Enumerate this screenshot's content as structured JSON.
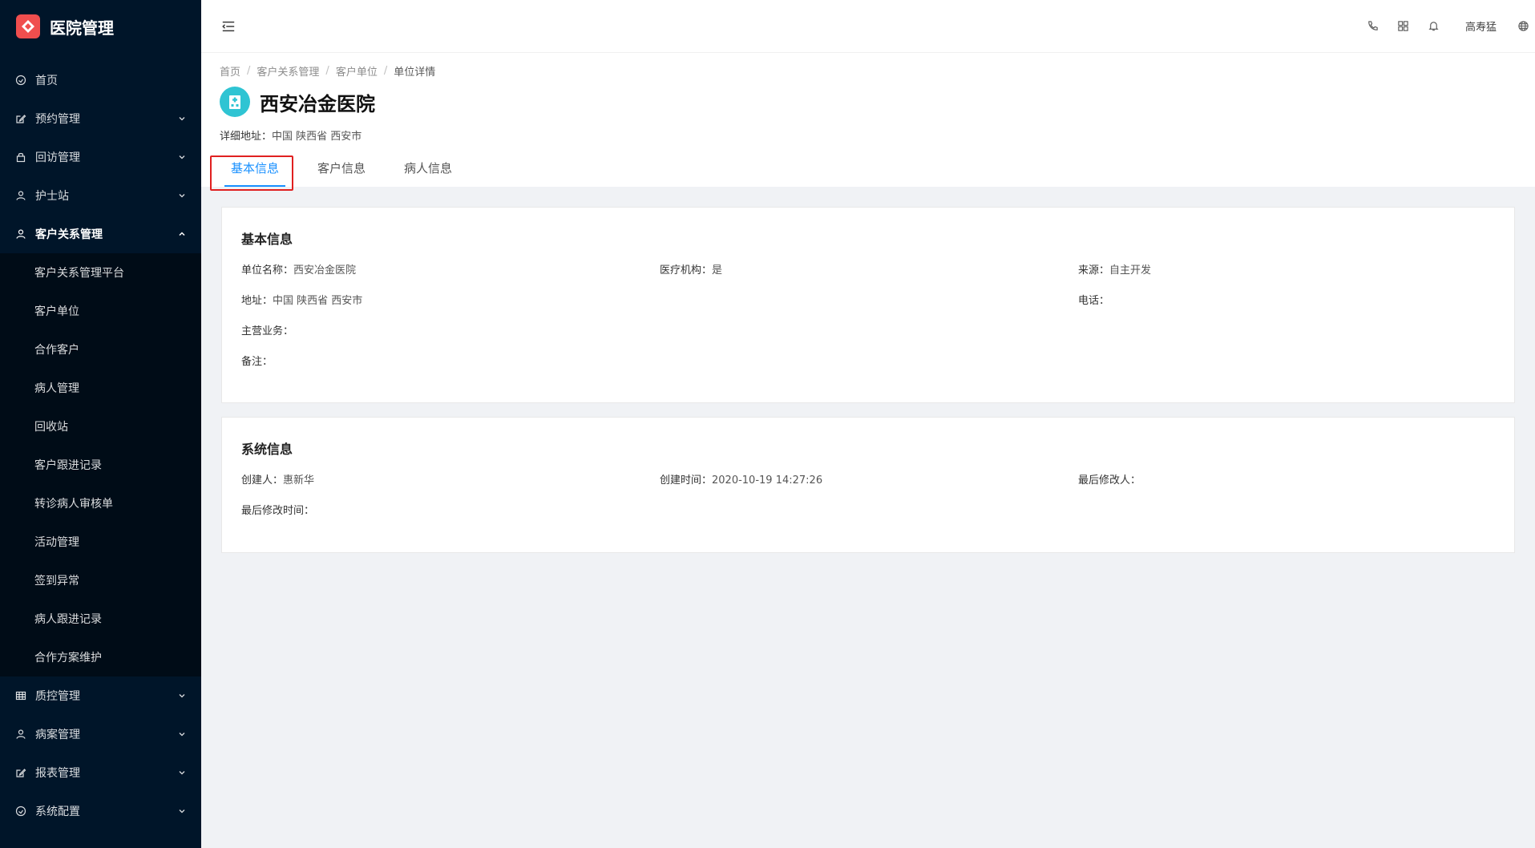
{
  "app": {
    "title": "医院管理"
  },
  "sidebar": {
    "items": [
      {
        "label": "首页",
        "icon": "dashboard-icon",
        "has_arrow": false
      },
      {
        "label": "预约管理",
        "icon": "edit-icon",
        "has_arrow": true
      },
      {
        "label": "回访管理",
        "icon": "lock-icon",
        "has_arrow": true
      },
      {
        "label": "护士站",
        "icon": "user-icon",
        "has_arrow": true
      },
      {
        "label": "客户关系管理",
        "icon": "user-icon",
        "has_arrow": true,
        "open": true
      },
      {
        "label": "质控管理",
        "icon": "table-icon",
        "has_arrow": true
      },
      {
        "label": "病案管理",
        "icon": "user-icon",
        "has_arrow": true
      },
      {
        "label": "报表管理",
        "icon": "edit-icon",
        "has_arrow": true
      },
      {
        "label": "系统配置",
        "icon": "dashboard-icon",
        "has_arrow": true
      }
    ],
    "submenu": [
      "客户关系管理平台",
      "客户单位",
      "合作客户",
      "病人管理",
      "回收站",
      "客户跟进记录",
      "转诊病人审核单",
      "活动管理",
      "签到异常",
      "病人跟进记录",
      "合作方案维护"
    ]
  },
  "header": {
    "user_name": "高寿猛",
    "icons": [
      "phone-icon",
      "apps-icon",
      "bell-icon",
      "globe-icon"
    ]
  },
  "breadcrumb": [
    "首页",
    "客户关系管理",
    "客户单位",
    "单位详情"
  ],
  "page": {
    "title": "西安冶金医院",
    "address_label": "详细地址：",
    "address_value": "中国 陕西省 西安市"
  },
  "tabs": [
    "基本信息",
    "客户信息",
    "病人信息"
  ],
  "basic_info": {
    "title": "基本信息",
    "fields": [
      {
        "label": "单位名称：",
        "value": "西安冶金医院"
      },
      {
        "label": "医疗机构：",
        "value": "是"
      },
      {
        "label": "来源：",
        "value": "自主开发"
      },
      {
        "label": "地址：",
        "value": "中国 陕西省 西安市"
      },
      {
        "label": "",
        "value": ""
      },
      {
        "label": "电话：",
        "value": ""
      },
      {
        "label": "主营业务：",
        "value": ""
      },
      {
        "label": "",
        "value": ""
      },
      {
        "label": "",
        "value": ""
      },
      {
        "label": "备注：",
        "value": ""
      }
    ]
  },
  "system_info": {
    "title": "系统信息",
    "fields": [
      {
        "label": "创建人：",
        "value": "惠新华"
      },
      {
        "label": "创建时间：",
        "value": "2020-10-19 14:27:26"
      },
      {
        "label": "最后修改人：",
        "value": ""
      },
      {
        "label": "最后修改时间：",
        "value": ""
      }
    ]
  },
  "colors": {
    "sidebar_bg": "#001529",
    "submenu_bg": "#000c17",
    "accent": "#1890ff",
    "logo": "#f04e4e",
    "highlight": "#e02020"
  }
}
